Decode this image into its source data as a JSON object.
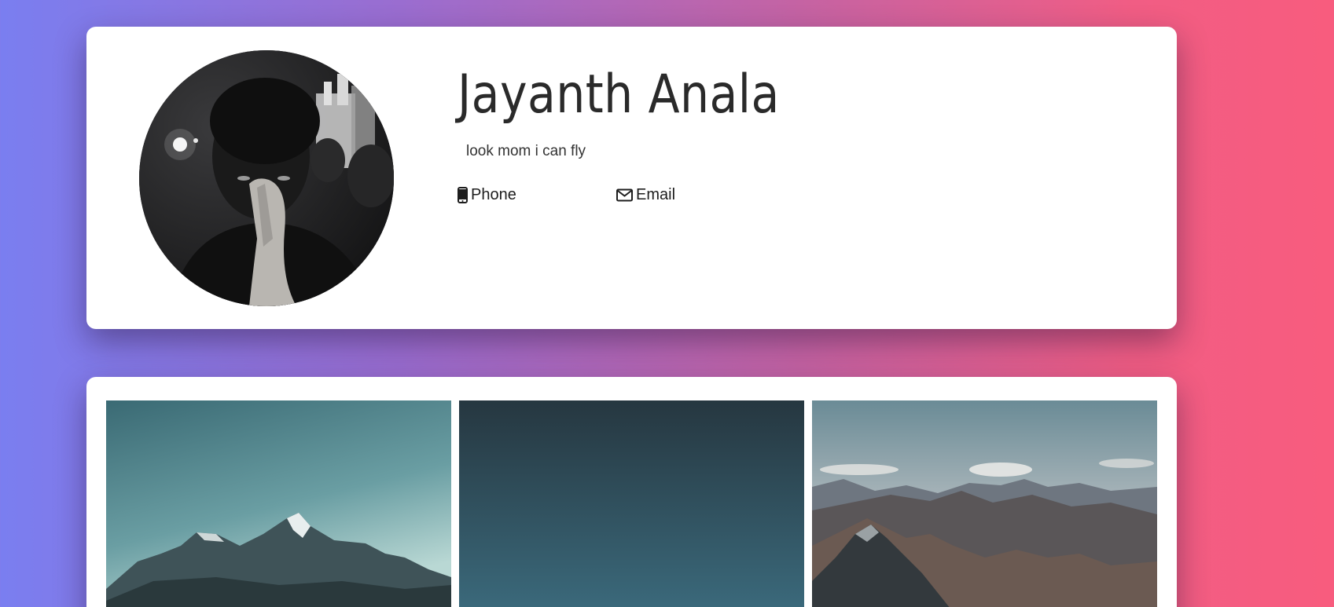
{
  "profile": {
    "name": "Jayanth Anala",
    "bio": "look mom i can fly",
    "avatar_icon": "profile-photo",
    "contacts": [
      {
        "label": "Phone",
        "icon": "mobile-phone-icon"
      },
      {
        "label": "Email",
        "icon": "envelope-icon"
      }
    ]
  },
  "gallery": {
    "photos": [
      {
        "subject": "snowy mountain peaks at dusk"
      },
      {
        "subject": "dark teal gradient sky"
      },
      {
        "subject": "mountain range panorama"
      }
    ]
  },
  "colors": {
    "gradient_start": "#7a7ef0",
    "gradient_end": "#f85c7e",
    "card": "#ffffff",
    "text": "#2a2a2a"
  }
}
